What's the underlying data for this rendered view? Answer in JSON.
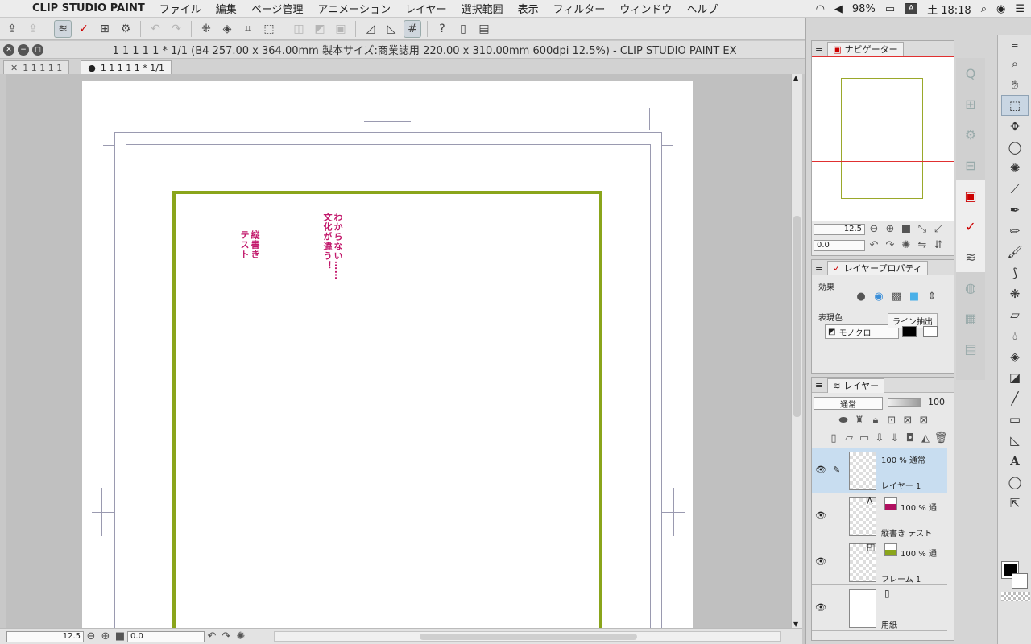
{
  "menubar": {
    "app_name": "CLIP STUDIO PAINT",
    "items": [
      "ファイル",
      "編集",
      "ページ管理",
      "アニメーション",
      "レイヤー",
      "選択範囲",
      "表示",
      "フィルター",
      "ウィンドウ",
      "ヘルプ"
    ],
    "battery": "98%",
    "input_indicator": "A",
    "clock": "土 18:18"
  },
  "document": {
    "title": "1 1 1 1 1 * 1/1 (B4 257.00 x 364.00mm 製本サイズ:商業誌用 220.00 x 310.00mm 600dpi 12.5%)  - CLIP STUDIO PAINT EX",
    "tabs": [
      "1 1 1 1 1",
      "1 1 1 1 1 * 1/1"
    ]
  },
  "canvas": {
    "text_1": "縦書き\nテスト",
    "text_2": "わからない……\n文化が違う！"
  },
  "status": {
    "zoom": "12.5",
    "rotation": "0.0"
  },
  "navigator": {
    "tab_label": "ナビゲーター",
    "zoom": "12.5",
    "rotation": "0.0"
  },
  "layer_property": {
    "tab_label": "レイヤープロパティ",
    "effect_label": "効果",
    "expression_label": "表現色",
    "expression_value": "モノクロ",
    "tooltip": "ライン抽出"
  },
  "layers_panel": {
    "tab_label": "レイヤー",
    "blend_mode": "通常",
    "opacity": "100",
    "layers": [
      {
        "meta": "100 % 通常",
        "name": "レイヤー 1"
      },
      {
        "meta": "100 % 通",
        "name": "縦書き テスト"
      },
      {
        "meta": "100 % 通",
        "name": "フレーム 1"
      },
      {
        "meta": "",
        "name": "用紙"
      }
    ]
  }
}
